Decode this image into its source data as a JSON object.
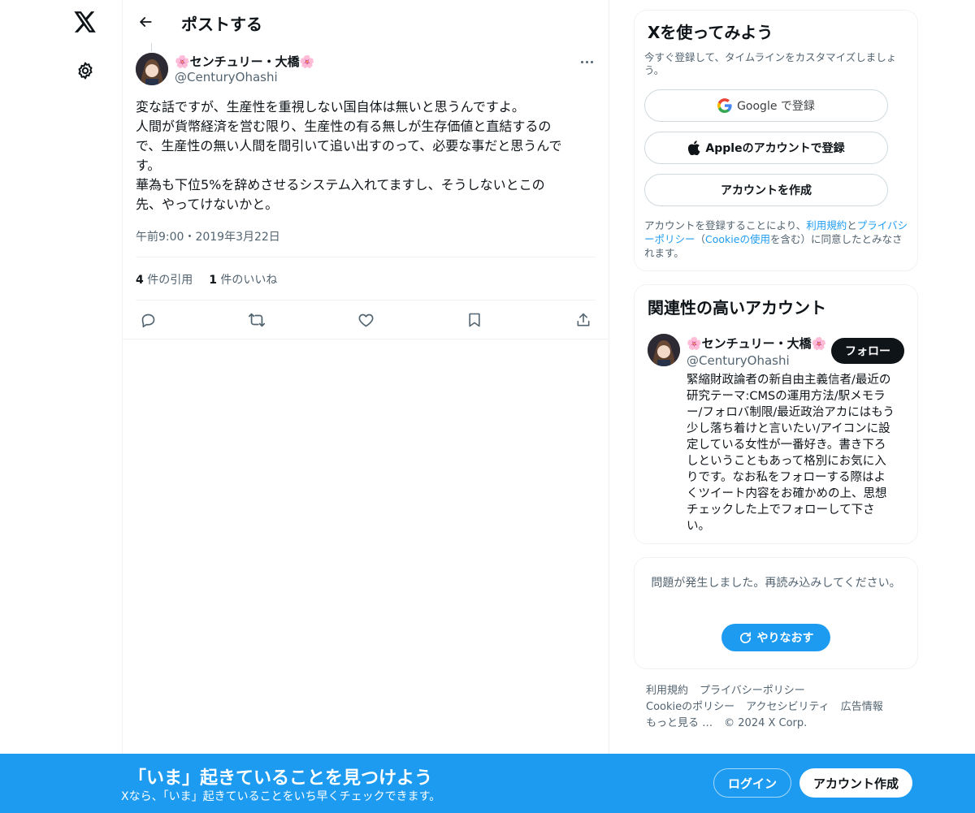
{
  "header": {
    "title": "ポストする"
  },
  "post": {
    "author_name": "🌸センチュリー・大橋🌸",
    "author_handle": "@CenturyOhashi",
    "text_lines": [
      "変な話ですが、生産性を重視しない国自体は無いと思うんですよ。",
      "人間が貨幣経済を営む限り、生産性の有る無しが生存価値と直結するの",
      "で、生産性の無い人間を間引いて追い出すのって、必要な事だと思うんで",
      "す。",
      "華為も下位5%を辞めさせるシステム入れてますし、そうしないとこの",
      "先、やってけないかと。"
    ],
    "timestamp": "午前9:00・2019年3月22日",
    "quotes_count": "4",
    "quotes_label": "件の引用",
    "likes_count": "1",
    "likes_label": "件のいいね"
  },
  "signup_card": {
    "title": "Xを使ってみよう",
    "subtitle": "今すぐ登録して、タイムラインをカスタマイズしましょう。",
    "google_label": "Google で登録",
    "apple_label": "Appleのアカウントで登録",
    "create_label": "アカウントを作成",
    "terms_prefix": "アカウントを登録することにより、",
    "terms_link": "利用規約",
    "terms_and": "と",
    "privacy_link": "プライバシーポリシー",
    "terms_paren_open": "（",
    "cookie_link": "Cookieの使用",
    "terms_suffix": "を含む）に同意したとみなされます。"
  },
  "related_card": {
    "title": "関連性の高いアカウント",
    "name": "🌸センチュリー・大橋🌸",
    "handle": "@CenturyOhashi",
    "follow_label": "フォロー",
    "bio_lines": [
      "緊縮財政論者の新自由主義信者/最近の",
      "研究テーマ:CMSの運用方法/駅メモラ",
      "ー/フォロバ制限/最近政治アカにはもう",
      "少し落ち着けと言いたい/アイコンに設",
      "定している女性が一番好き。書き下ろ",
      "しということもあって格別にお気に入",
      "りです。なお私をフォローする際はよ",
      "くツイート内容をお確かめの上、思想",
      "チェックした上でフォローして下さ",
      "い。"
    ]
  },
  "error_card": {
    "message": "問題が発生しました。再読み込みしてください。",
    "retry_label": "やりなおす"
  },
  "footer": {
    "row1": [
      "利用規約",
      "プライバシーポリシー"
    ],
    "row2": [
      "Cookieのポリシー",
      "アクセシビリティ",
      "広告情報"
    ],
    "more": "もっと見る …",
    "copyright": "© 2024 X Corp."
  },
  "bottom_bar": {
    "title": "「いま」起きていることを見つけよう",
    "subtitle": "Xなら、「いま」起きていることをいち早くチェックできます。",
    "login_label": "ログイン",
    "signup_label": "アカウント作成"
  },
  "colors": {
    "accent": "#1d9bf0",
    "text": "#0f1419",
    "muted": "#536471",
    "border": "#eff3f4"
  },
  "icons": [
    "x-logo-icon",
    "gear-icon",
    "back-arrow-icon",
    "more-icon",
    "reply-icon",
    "repost-icon",
    "like-icon",
    "bookmark-icon",
    "share-icon",
    "google-icon",
    "apple-icon",
    "refresh-icon"
  ]
}
